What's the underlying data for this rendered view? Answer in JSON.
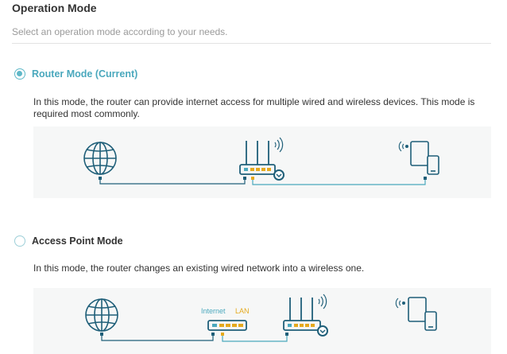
{
  "page": {
    "title": "Operation Mode",
    "subtitle": "Select an operation mode according to your needs."
  },
  "modes": [
    {
      "label": "Router Mode (Current)",
      "selected": true,
      "description": "In this mode, the router can provide internet access for multiple wired and wireless devices. This mode is required most commonly."
    },
    {
      "label": "Access Point Mode",
      "selected": false,
      "description": "In this mode, the router changes an existing wired network into a wireless one.",
      "diagram_labels": {
        "internet": "Internet",
        "lan": "LAN"
      }
    }
  ],
  "colors": {
    "accent": "#4aa8bd",
    "icon": "#1f5f79",
    "lan": "#e5a91d",
    "panel": "#f6f7f7"
  },
  "icons": [
    "globe-icon",
    "router-icon",
    "wireless-devices-icon",
    "modem-icon"
  ]
}
